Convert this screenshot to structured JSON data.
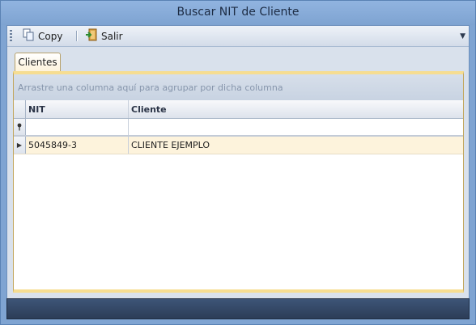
{
  "window": {
    "title": "Buscar NIT de Cliente"
  },
  "toolbar": {
    "copy_label": "Copy",
    "copy_icon": "copy-icon",
    "exit_label": "Salir",
    "exit_icon": "exit-door-icon"
  },
  "tabs": [
    {
      "label": "Clientes",
      "active": true
    }
  ],
  "grid": {
    "group_panel_text": "Arrastre una columna aquí para agrupar por dicha columna",
    "columns": [
      "NIT",
      "Cliente"
    ],
    "filter_row": {
      "nit": "",
      "cliente": ""
    },
    "rows": [
      {
        "nit": "5045849-3",
        "cliente": "CLIENTE EJEMPLO"
      }
    ]
  },
  "colors": {
    "title_bar": "#88ADDB",
    "selected_row": "#FDF3DC",
    "tab_accent": "#F6DD91",
    "status_bar": "#34496A"
  }
}
